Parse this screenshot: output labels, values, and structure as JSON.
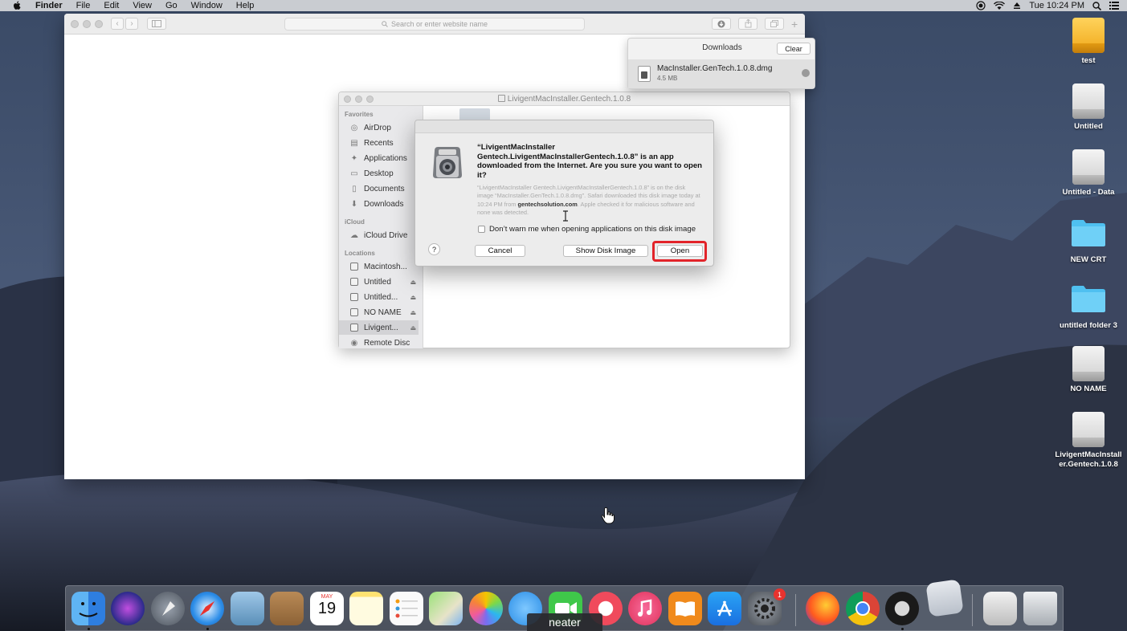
{
  "menubar": {
    "app": "Finder",
    "items": [
      "File",
      "Edit",
      "View",
      "Go",
      "Window",
      "Help"
    ],
    "clock": "Tue 10:24 PM"
  },
  "safari": {
    "url_placeholder": "Search or enter website name"
  },
  "downloads": {
    "title": "Downloads",
    "clear_label": "Clear",
    "file_name": "MacInstaller.GenTech.1.0.8.dmg",
    "file_size": "4.5 MB"
  },
  "finder": {
    "title": "LivigentMacInstaller.Gentech.1.0.8",
    "sections": {
      "favorites": "Favorites",
      "icloud": "iCloud",
      "locations": "Locations"
    },
    "favorites": [
      "AirDrop",
      "Recents",
      "Applications",
      "Desktop",
      "Documents",
      "Downloads"
    ],
    "icloud": [
      "iCloud Drive"
    ],
    "locations": [
      "Macintosh...",
      "Untitled",
      "Untitled...",
      "NO NAME",
      "Livigent...",
      "Remote Disc"
    ]
  },
  "alert": {
    "headline": "“LivigentMacInstaller Gentech.LivigentMacInstallerGentech.1.0.8” is an app downloaded from the Internet. Are you sure you want to open it?",
    "body_pre": "“LivigentMacInstaller Gentech.LivigentMacInstallerGentech.1.0.8” is on the disk image “MacInstaller.GenTech.1.0.8.dmg”. Safari downloaded this disk image today at 10:24 PM from ",
    "body_domain": "gentechsolution.com",
    "body_post": ". Apple checked it for malicious software and none was detected.",
    "checkbox_label": "Don’t warn me when opening applications on this disk image",
    "help_label": "?",
    "cancel_label": "Cancel",
    "show_disk_label": "Show Disk Image",
    "open_label": "Open"
  },
  "desktop_icons": [
    "test",
    "Untitled",
    "Untitled - Data",
    "NEW CRT",
    "untitled folder 3",
    "NO NAME",
    "LivigentMacInstaller.Gentech.1.0.8"
  ],
  "dock": {
    "tooltip": "neater",
    "badge": "1",
    "calendar_month": "MAY",
    "calendar_day": "19"
  },
  "colors": {
    "highlight": "#e2242a",
    "folder_blue": "#4fc0f0",
    "dock_badge": "#e8322e"
  }
}
